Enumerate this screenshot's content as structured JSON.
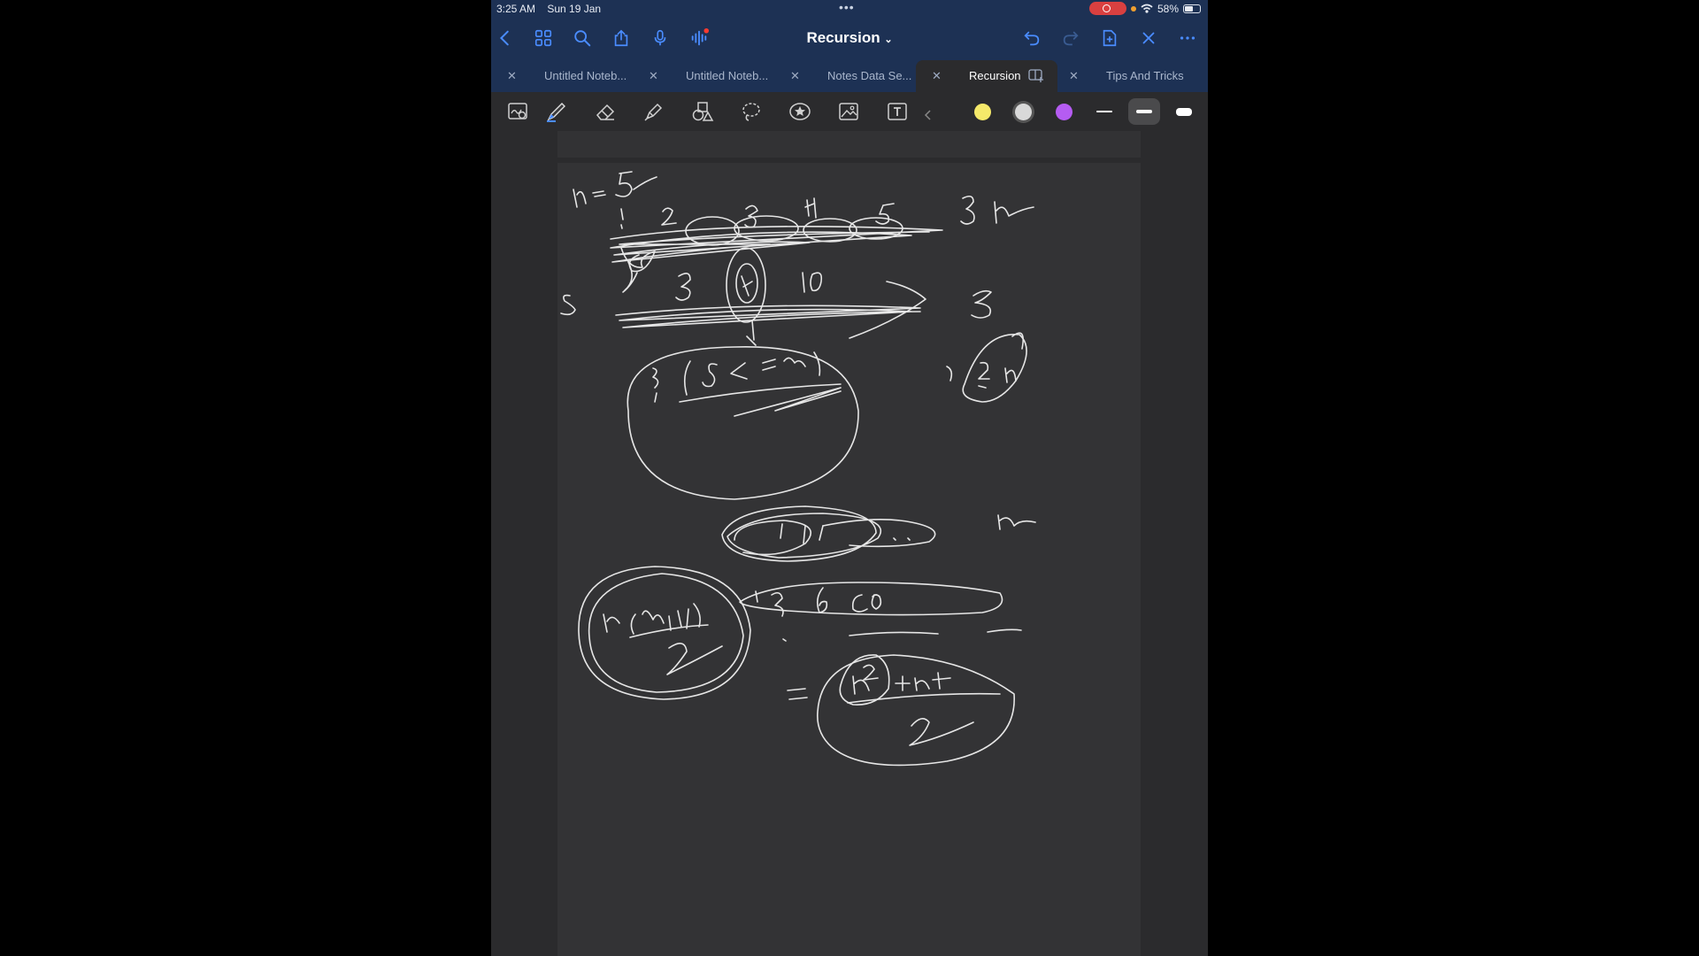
{
  "status_bar": {
    "time": "3:25 AM",
    "date": "Sun 19 Jan",
    "battery": "58%",
    "battery_level": 0.58
  },
  "nav": {
    "title": "Recursion",
    "icons": [
      "back-icon",
      "grid-icon",
      "search-icon",
      "share-icon",
      "microphone-icon",
      "audio-waveform-icon",
      "undo-icon",
      "redo-icon",
      "add-page-icon",
      "close-icon",
      "more-icon"
    ]
  },
  "tabs": [
    {
      "label": "Untitled Noteb..."
    },
    {
      "label": "Untitled Noteb..."
    },
    {
      "label": "Notes Data Se..."
    },
    {
      "label": "Recursion",
      "active": true
    },
    {
      "label": "Tips And Tricks"
    }
  ],
  "toolbar": {
    "tools": [
      "zoom-window-icon",
      "pen-icon",
      "eraser-icon",
      "highlighter-icon",
      "shapes-icon",
      "lasso-icon",
      "sticker-icon",
      "image-icon",
      "text-icon"
    ],
    "colors": [
      "#f5e96a",
      "#d9d9d9",
      "#b55cf2"
    ],
    "selected_color": "#d9d9d9",
    "stroke_widths": [
      "thin",
      "medium",
      "thick"
    ],
    "selected_stroke": "medium"
  },
  "colors": {
    "nav_bg": "#1d3154",
    "canvas_bg": "#2b2b2d",
    "page_bg": "#333335",
    "ink": "#e6e6e6",
    "accent": "#4a8cff"
  }
}
